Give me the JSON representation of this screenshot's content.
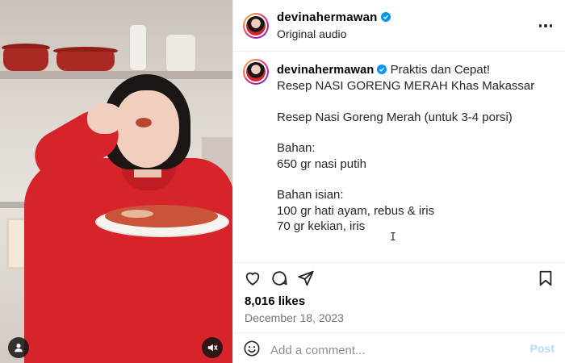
{
  "post": {
    "username": "devinahermawan",
    "verified": true,
    "audio_label": "Original audio"
  },
  "caption": {
    "username": "devinahermawan",
    "text": " Praktis dan Cepat!\nResep NASI GORENG MERAH Khas Makassar\n\nResep Nasi Goreng Merah (untuk 3-4 porsi)\n\nBahan:\n650 gr nasi putih\n\nBahan isian:\n100 gr hati ayam, rebus & iris\n70 gr kekian, iris"
  },
  "stats": {
    "likes": "8,016 likes",
    "date": "December 18, 2023"
  },
  "comment": {
    "placeholder": "Add a comment...",
    "post_label": "Post"
  },
  "colors": {
    "verified": "#0095f6",
    "post_disabled": "#b3dbff",
    "shirt": "#d7232a"
  },
  "icons": [
    "user-icon",
    "mute-icon",
    "more-icon",
    "verified-icon",
    "heart-icon",
    "comment-icon",
    "share-icon",
    "bookmark-icon",
    "emoji-icon"
  ]
}
